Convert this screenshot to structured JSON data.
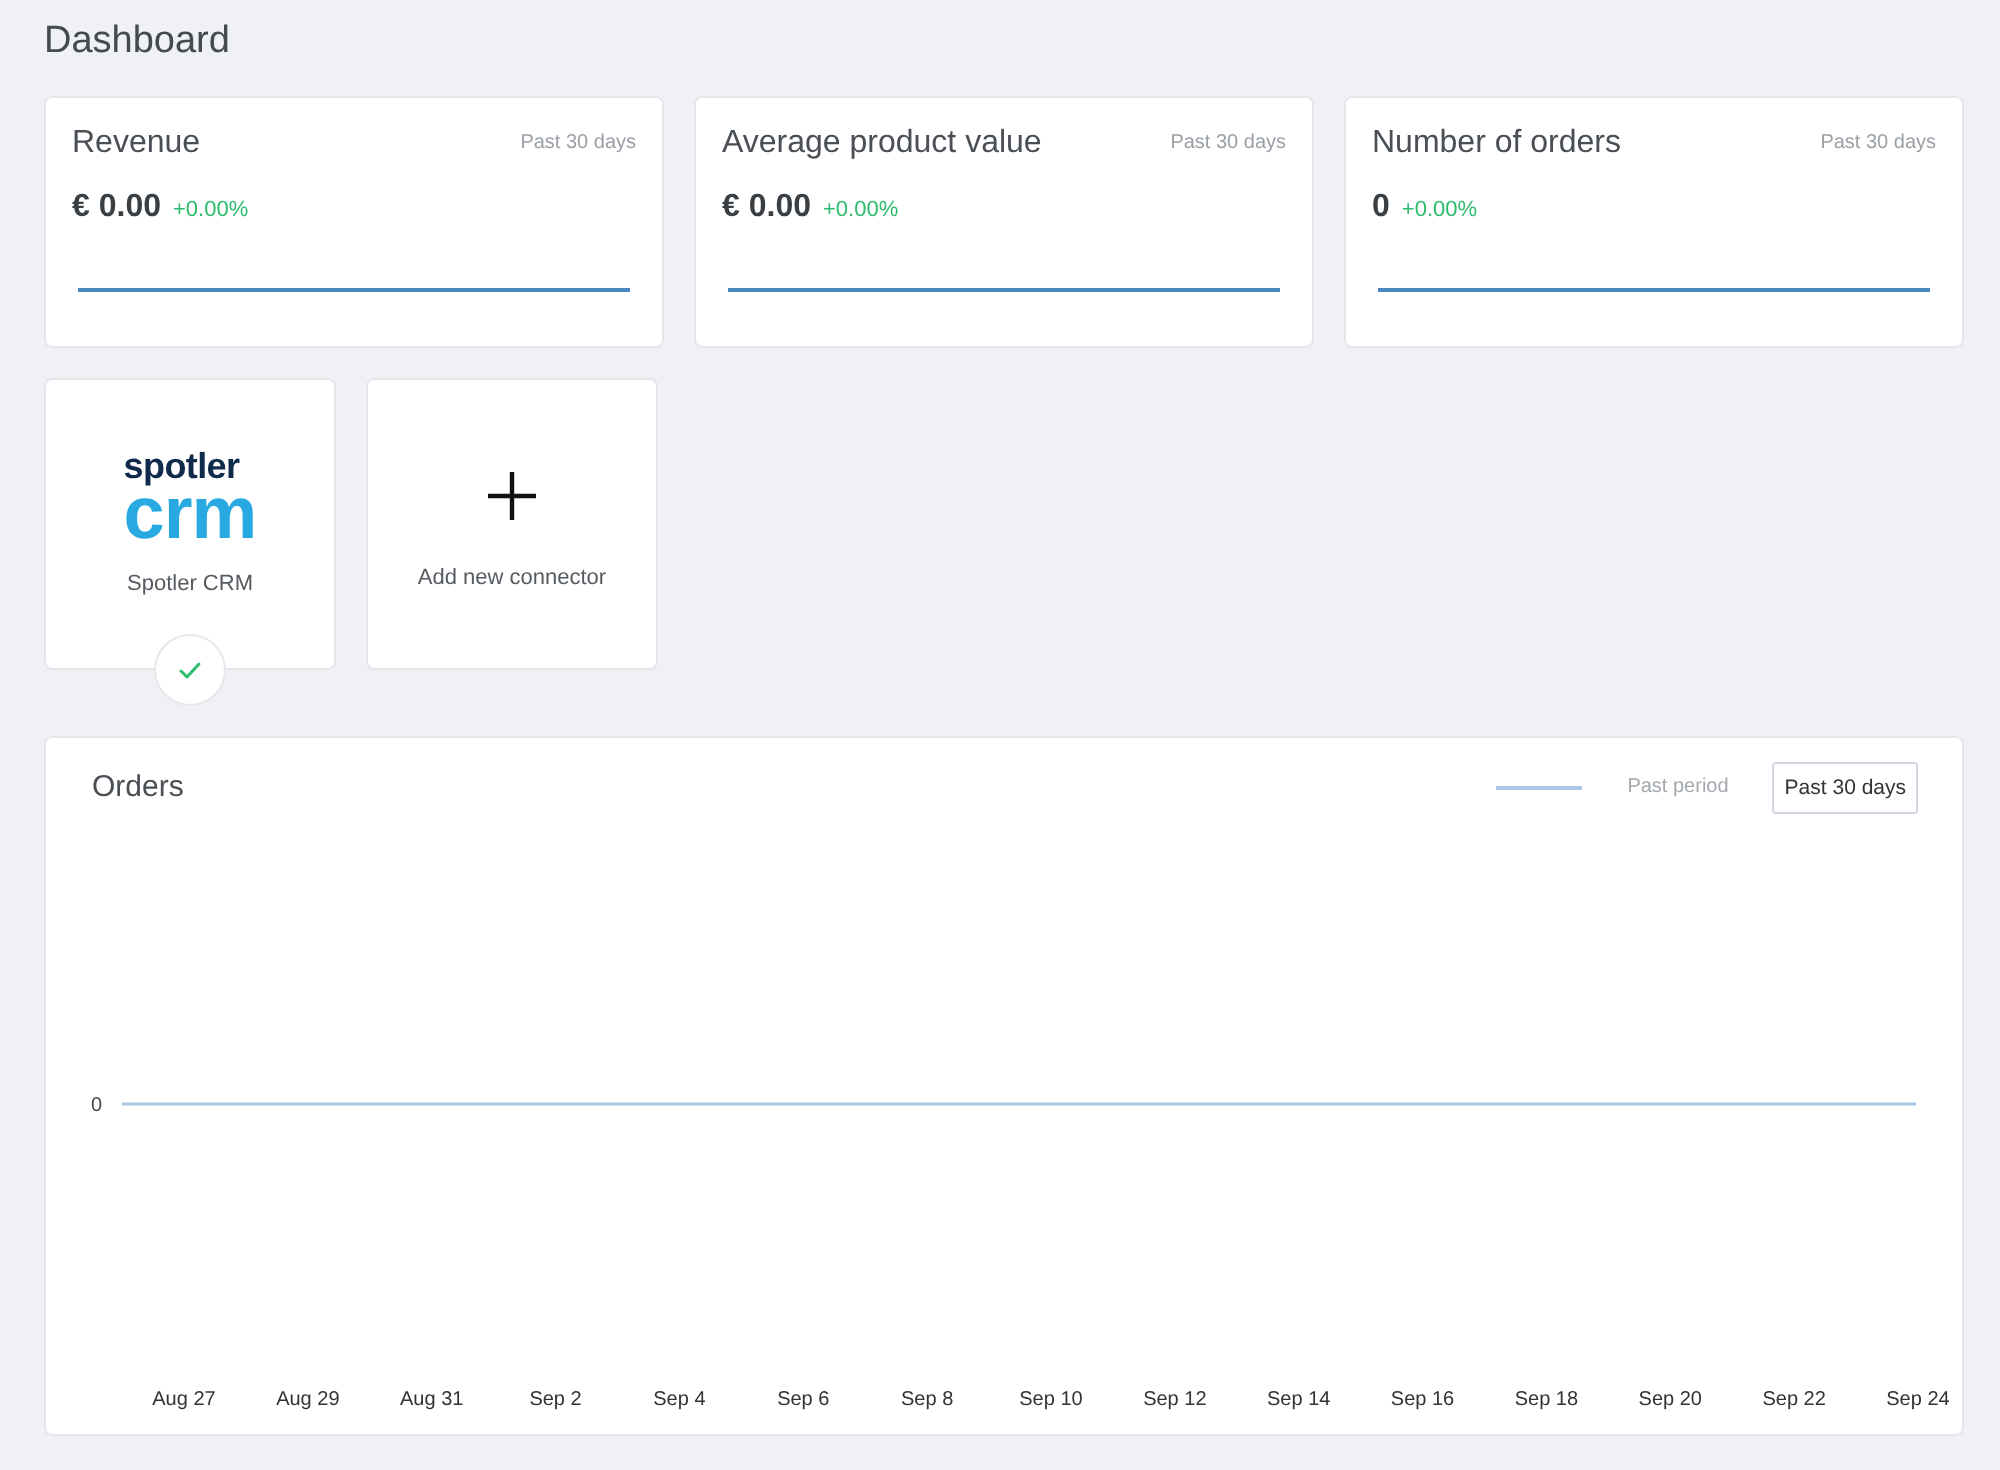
{
  "page": {
    "title": "Dashboard"
  },
  "stats": [
    {
      "title": "Revenue",
      "period": "Past 30 days",
      "value": "€ 0.00",
      "change": "+0.00%"
    },
    {
      "title": "Average product value",
      "period": "Past 30 days",
      "value": "€ 0.00",
      "change": "+0.00%"
    },
    {
      "title": "Number of orders",
      "period": "Past 30 days",
      "value": "0",
      "change": "+0.00%"
    }
  ],
  "connectors": [
    {
      "kind": "integration",
      "logo": {
        "line_1": "spotler",
        "line_2": "crm"
      },
      "name": "Spotler CRM",
      "connected": true
    },
    {
      "kind": "add",
      "label": "Add new connector"
    }
  ],
  "orders": {
    "title": "Orders",
    "legend_label": "Past period",
    "range_button": "Past 30 days",
    "y_axis_label": "0",
    "x_axis_labels": [
      "Aug 27",
      "Aug 29",
      "Aug 31",
      "Sep 2",
      "Sep 4",
      "Sep 6",
      "Sep 8",
      "Sep 10",
      "Sep 12",
      "Sep 14",
      "Sep 16",
      "Sep 18",
      "Sep 20",
      "Sep 22",
      "Sep 24"
    ]
  }
}
